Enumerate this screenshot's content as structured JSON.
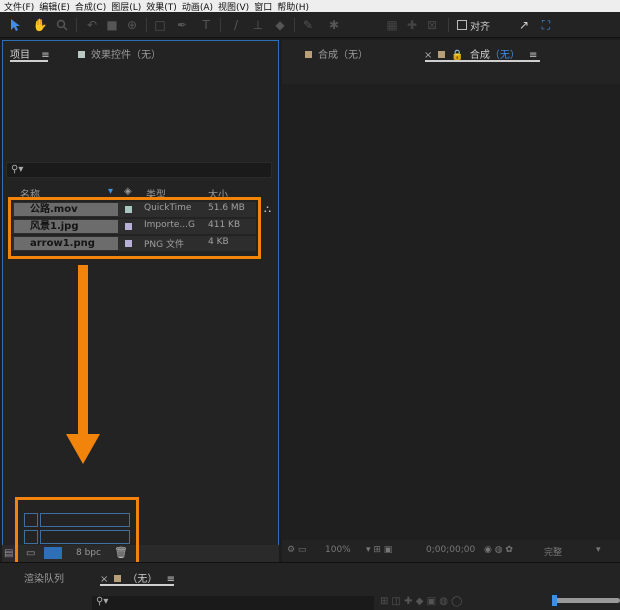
{
  "menu": [
    "文件(F)",
    "编辑(E)",
    "合成(C)",
    "图层(L)",
    "效果(T)",
    "动画(A)",
    "视图(V)",
    "窗口",
    "帮助(H)"
  ],
  "toolbar": {
    "align_label": "对齐"
  },
  "left_tabs": {
    "project": "项目",
    "effects": "效果控件（无）"
  },
  "right_tabs": {
    "comp_none": "合成（无）",
    "comp_prefix": "合成",
    "comp_active_value": "（无）"
  },
  "columns": {
    "name": "名称",
    "type": "类型",
    "size": "大小"
  },
  "files": [
    {
      "name": "公路.mov",
      "type": "QuickTime",
      "size": "51.6 MB",
      "type_color": "#a8c7c0"
    },
    {
      "name": "风景1.jpg",
      "type": "Importe...G",
      "size": "411 KB",
      "type_color": "#b8b0d8"
    },
    {
      "name": "arrow1.png",
      "type": "PNG 文件",
      "size": "4 KB",
      "type_color": "#b8b0d8"
    }
  ],
  "project_footer": {
    "bpc": "8 bpc"
  },
  "viewer": {
    "zoom": "100%",
    "timecode": "0;00;00;00",
    "resolution": "完整"
  },
  "render_tabs": {
    "queue": "渲染队列",
    "none": "（无）"
  },
  "colors": {
    "highlight": "#f2840b",
    "active_border": "#2f6fb8",
    "comp_swatch": "#b89f78"
  }
}
